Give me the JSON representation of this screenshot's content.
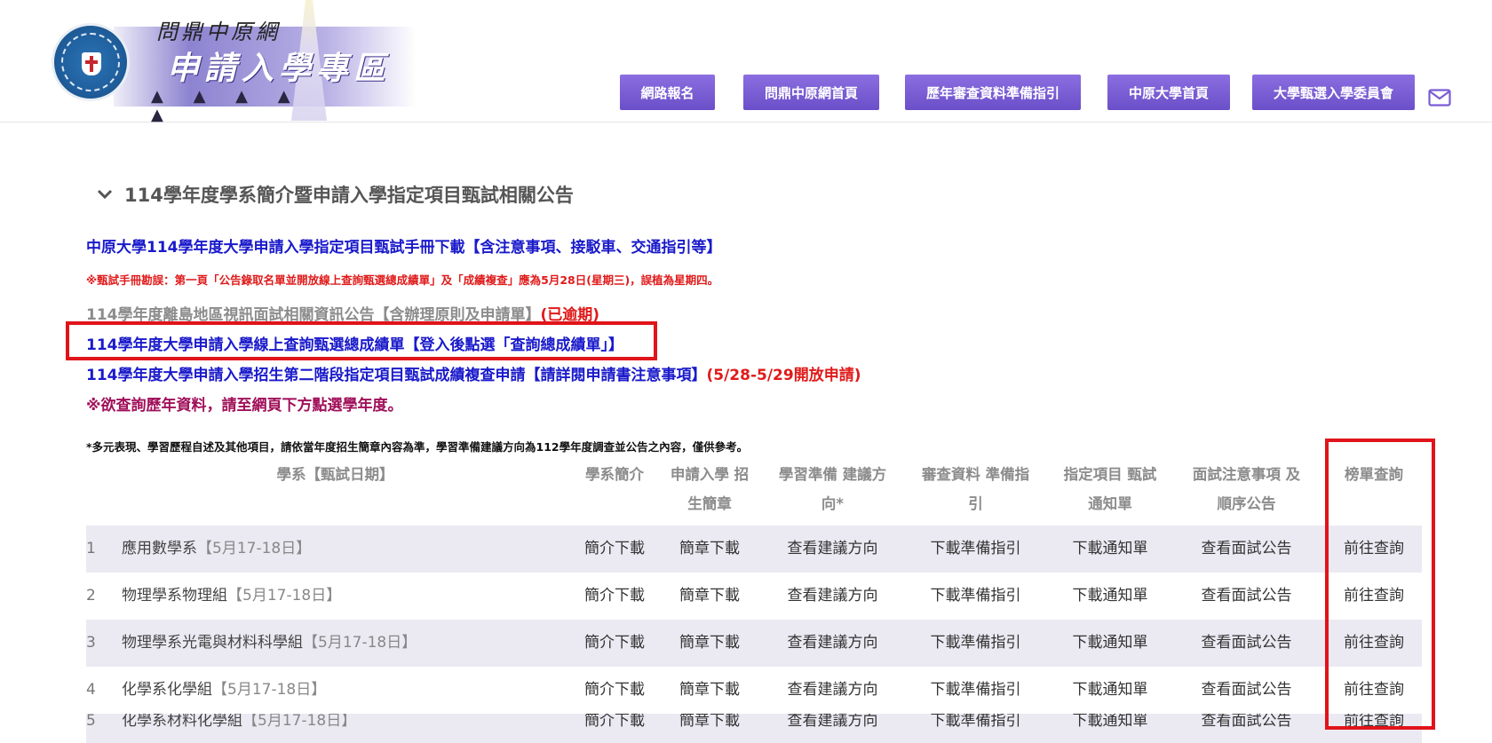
{
  "header": {
    "logo_small_text": "問鼎中原網",
    "logo_main_text": "申請入學專區",
    "nav": [
      {
        "label": "網路報名"
      },
      {
        "label": "問鼎中原網首頁"
      },
      {
        "label": "歷年審查資料準備指引"
      },
      {
        "label": "中原大學首頁"
      },
      {
        "label": "大學甄選入學委員會"
      }
    ],
    "icons": {
      "logo": "university-emblem",
      "mail": "mail-icon"
    },
    "nav_color": "#7a5cd6"
  },
  "section": {
    "title": "114學年度學系簡介暨申請入學指定項目甄試相關公告",
    "lines": {
      "handbook": "中原大學114學年度大學申請入學指定項目甄試手冊下載【含注意事項、接駁車、交通指引等】",
      "erratum": "※甄試手冊勘誤：第一頁「公告錄取名單並開放線上查詢甄選總成績單」及「成績複查」應為5月28日(星期三)，誤植為星期四。",
      "island_main": "114學年度離島地區視訊面試相關資訊公告【含辦理原則及申請單】",
      "island_status": "(已逾期)",
      "score_query": "114學年度大學申請入學線上查詢甄選總成績單【登入後點選「查詢總成績單」】",
      "review_main": "114學年度大學申請入學招生第二階段指定項目甄試成績複查申請【請詳閱申請書注意事項】",
      "review_dates": "(5/28-5/29開放申請)",
      "history_note": "※欲查詢歷年資料，請至網頁下方點選學年度。"
    },
    "colors": {
      "link_blue": "#1a1acb",
      "alert_red": "#e01a1a",
      "expired_grey": "#8c8c8c",
      "note_maroon": "#a0105a",
      "highlight_box": "#e0141a"
    }
  },
  "note": "*多元表現、學習歷程自述及其他項目，請依當年度招生簡章內容為準，學習準備建議方向為112學年度調查並公告之內容，僅供參考。",
  "table": {
    "headers": {
      "dept": "學系【甄試日期】",
      "intro": "學系簡介",
      "brochure_l1": "申請入學 招",
      "brochure_l2": "生簡章",
      "prep_l1": "學習準備 建議方",
      "prep_l2": "向*",
      "review_l1": "審查資料 準備指",
      "review_l2": "引",
      "notice_l1": "指定項目 甄試",
      "notice_l2": "通知單",
      "interview_l1": "面試注意事項 及",
      "interview_l2": "順序公告",
      "result": "榜單查詢"
    },
    "rows": [
      {
        "num": "1",
        "dept": "應用數學系",
        "date": "【5月17-18日】",
        "intro": "簡介下載",
        "brochure": "簡章下載",
        "prep": "查看建議方向",
        "review": "下載準備指引",
        "notice": "下載通知單",
        "interview": "查看面試公告",
        "result": "前往查詢"
      },
      {
        "num": "2",
        "dept": "物理學系物理組",
        "date": "【5月17-18日】",
        "intro": "簡介下載",
        "brochure": "簡章下載",
        "prep": "查看建議方向",
        "review": "下載準備指引",
        "notice": "下載通知單",
        "interview": "查看面試公告",
        "result": "前往查詢"
      },
      {
        "num": "3",
        "dept": "物理學系光電與材料科學組",
        "date": "【5月17-18日】",
        "intro": "簡介下載",
        "brochure": "簡章下載",
        "prep": "查看建議方向",
        "review": "下載準備指引",
        "notice": "下載通知單",
        "interview": "查看面試公告",
        "result": "前往查詢"
      },
      {
        "num": "4",
        "dept": "化學系化學組",
        "date": "【5月17-18日】",
        "intro": "簡介下載",
        "brochure": "簡章下載",
        "prep": "查看建議方向",
        "review": "下載準備指引",
        "notice": "下載通知單",
        "interview": "查看面試公告",
        "result": "前往查詢"
      },
      {
        "num": "5",
        "dept": "化學系材料化學組",
        "date": "【5月17-18日】",
        "intro": "簡介下載",
        "brochure": "簡章下載",
        "prep": "查看建議方向",
        "review": "下載準備指引",
        "notice": "下載通知單",
        "interview": "查看面試公告",
        "result": "前往查詢"
      }
    ]
  }
}
